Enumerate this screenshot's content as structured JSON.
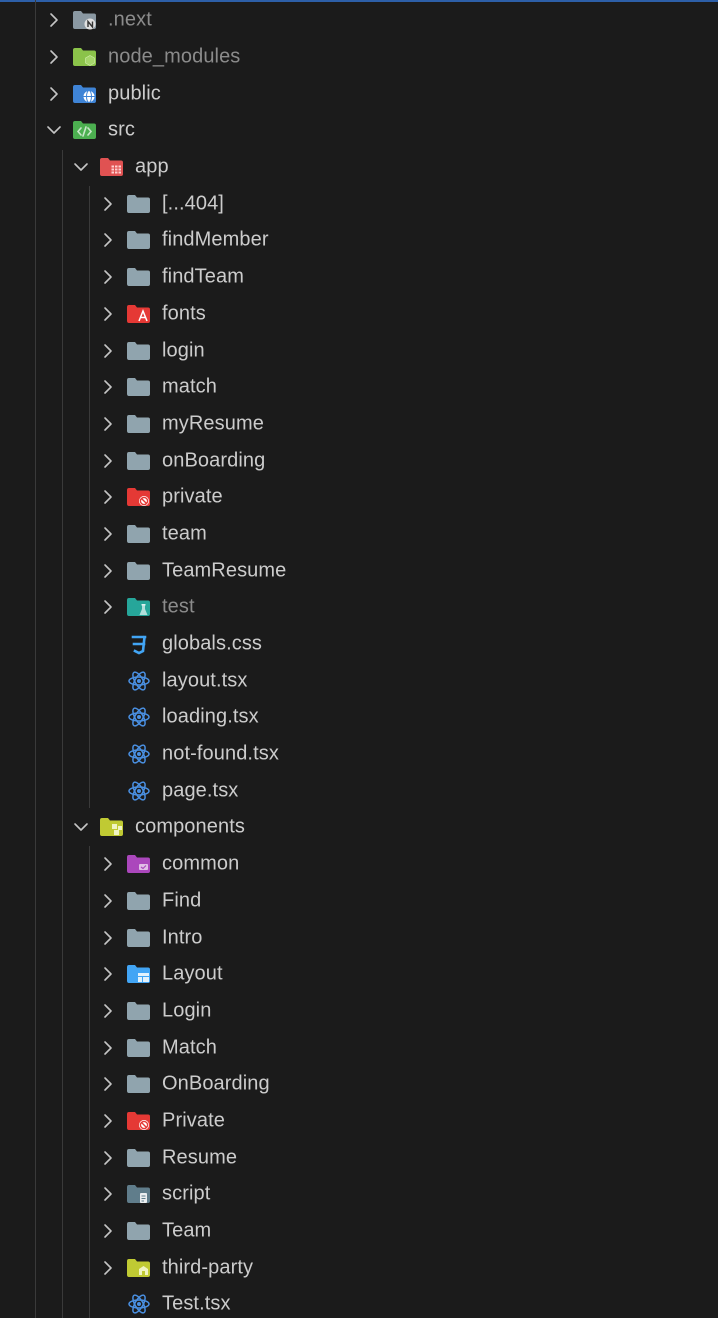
{
  "explorer": {
    "items": [
      {
        "label": ".next",
        "depth": 0,
        "chevron": "right",
        "icon": "folder-next-icon",
        "dim": true
      },
      {
        "label": "node_modules",
        "depth": 0,
        "chevron": "right",
        "icon": "folder-node-icon",
        "dim": true
      },
      {
        "label": "public",
        "depth": 0,
        "chevron": "right",
        "icon": "folder-public-icon",
        "dim": false
      },
      {
        "label": "src",
        "depth": 0,
        "chevron": "down",
        "icon": "folder-src-icon",
        "dim": false
      },
      {
        "label": "app",
        "depth": 1,
        "chevron": "down",
        "icon": "folder-app-icon",
        "dim": false
      },
      {
        "label": "[...404]",
        "depth": 2,
        "chevron": "right",
        "icon": "folder-icon",
        "dim": false
      },
      {
        "label": "findMember",
        "depth": 2,
        "chevron": "right",
        "icon": "folder-icon",
        "dim": false
      },
      {
        "label": "findTeam",
        "depth": 2,
        "chevron": "right",
        "icon": "folder-icon",
        "dim": false
      },
      {
        "label": "fonts",
        "depth": 2,
        "chevron": "right",
        "icon": "folder-fonts-icon",
        "dim": false
      },
      {
        "label": "login",
        "depth": 2,
        "chevron": "right",
        "icon": "folder-icon",
        "dim": false
      },
      {
        "label": "match",
        "depth": 2,
        "chevron": "right",
        "icon": "folder-icon",
        "dim": false
      },
      {
        "label": "myResume",
        "depth": 2,
        "chevron": "right",
        "icon": "folder-icon",
        "dim": false
      },
      {
        "label": "onBoarding",
        "depth": 2,
        "chevron": "right",
        "icon": "folder-icon",
        "dim": false
      },
      {
        "label": "private",
        "depth": 2,
        "chevron": "right",
        "icon": "folder-private-icon",
        "dim": false
      },
      {
        "label": "team",
        "depth": 2,
        "chevron": "right",
        "icon": "folder-icon",
        "dim": false
      },
      {
        "label": "TeamResume",
        "depth": 2,
        "chevron": "right",
        "icon": "folder-icon",
        "dim": false
      },
      {
        "label": "test",
        "depth": 2,
        "chevron": "right",
        "icon": "folder-test-icon",
        "dim": true
      },
      {
        "label": "globals.css",
        "depth": 2,
        "chevron": "none",
        "icon": "css-file-icon",
        "dim": false
      },
      {
        "label": "layout.tsx",
        "depth": 2,
        "chevron": "none",
        "icon": "react-file-icon",
        "dim": false
      },
      {
        "label": "loading.tsx",
        "depth": 2,
        "chevron": "none",
        "icon": "react-file-icon",
        "dim": false
      },
      {
        "label": "not-found.tsx",
        "depth": 2,
        "chevron": "none",
        "icon": "react-file-icon",
        "dim": false
      },
      {
        "label": "page.tsx",
        "depth": 2,
        "chevron": "none",
        "icon": "react-file-icon",
        "dim": false
      },
      {
        "label": "components",
        "depth": 1,
        "chevron": "down",
        "icon": "folder-components-icon",
        "dim": false
      },
      {
        "label": "common",
        "depth": 2,
        "chevron": "right",
        "icon": "folder-common-icon",
        "dim": false
      },
      {
        "label": "Find",
        "depth": 2,
        "chevron": "right",
        "icon": "folder-icon",
        "dim": false
      },
      {
        "label": "Intro",
        "depth": 2,
        "chevron": "right",
        "icon": "folder-icon",
        "dim": false
      },
      {
        "label": "Layout",
        "depth": 2,
        "chevron": "right",
        "icon": "folder-layout-icon",
        "dim": false
      },
      {
        "label": "Login",
        "depth": 2,
        "chevron": "right",
        "icon": "folder-icon",
        "dim": false
      },
      {
        "label": "Match",
        "depth": 2,
        "chevron": "right",
        "icon": "folder-icon",
        "dim": false
      },
      {
        "label": "OnBoarding",
        "depth": 2,
        "chevron": "right",
        "icon": "folder-icon",
        "dim": false
      },
      {
        "label": "Private",
        "depth": 2,
        "chevron": "right",
        "icon": "folder-private-icon",
        "dim": false
      },
      {
        "label": "Resume",
        "depth": 2,
        "chevron": "right",
        "icon": "folder-icon",
        "dim": false
      },
      {
        "label": "script",
        "depth": 2,
        "chevron": "right",
        "icon": "folder-script-icon",
        "dim": false
      },
      {
        "label": "Team",
        "depth": 2,
        "chevron": "right",
        "icon": "folder-icon",
        "dim": false
      },
      {
        "label": "third-party",
        "depth": 2,
        "chevron": "right",
        "icon": "folder-third-party-icon",
        "dim": false
      },
      {
        "label": "Test.tsx",
        "depth": 2,
        "chevron": "none",
        "icon": "react-file-icon",
        "dim": false
      }
    ]
  },
  "colors": {
    "background": "#1b1b1b",
    "text": "#cccccc",
    "text_dim": "#8b8b8b",
    "folder": "#90a4ae",
    "react": "#4a90e2",
    "css": "#42a5f5",
    "accent": "#2d5fa8"
  }
}
